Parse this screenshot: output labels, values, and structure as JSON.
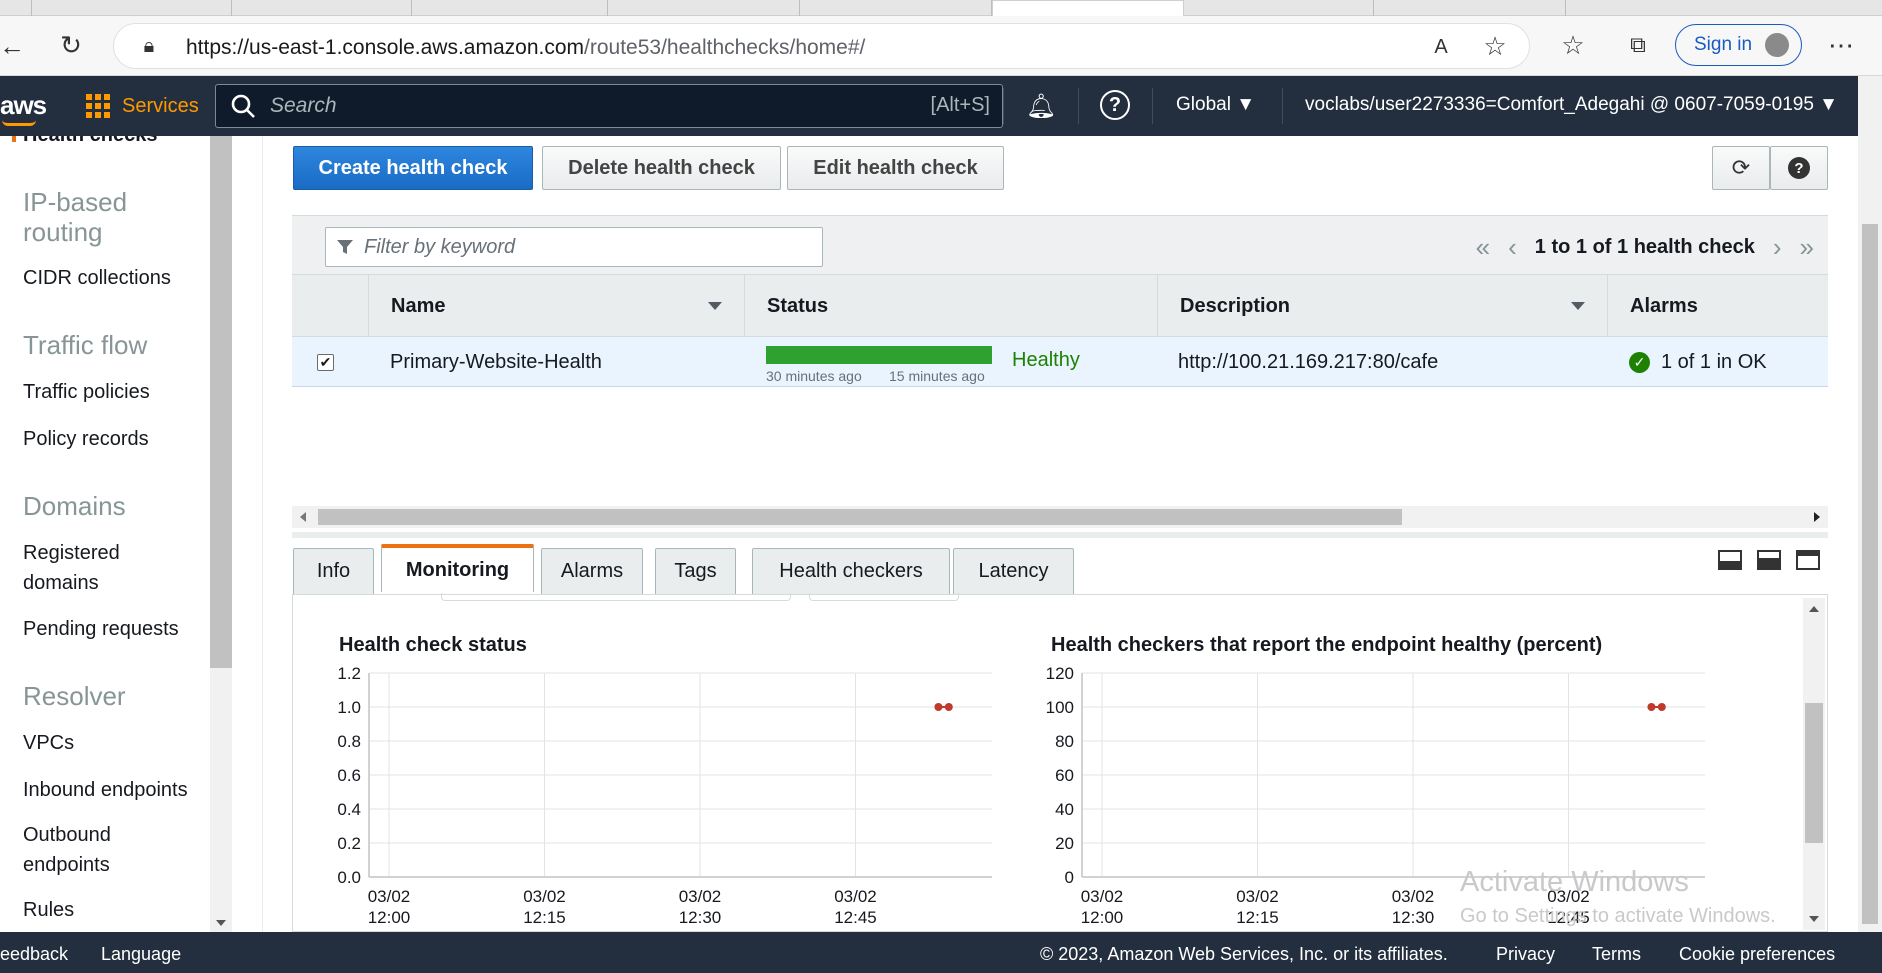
{
  "browser": {
    "url_host": "https://us-east-1.console.aws.amazon.com",
    "url_path": "/route53/healthchecks/home#/",
    "sign_in": "Sign in"
  },
  "aws_nav": {
    "logo": "aws",
    "services": "Services",
    "search_placeholder": "Search",
    "search_shortcut": "[Alt+S]",
    "region": "Global ▼",
    "account": "voclabs/user2273336=Comfort_Adegahi @ 0607-7059-0195 ▼"
  },
  "sidebar": {
    "cut_item": "Health checks",
    "ip_routing": "IP-based routing",
    "cidr": "CIDR collections",
    "traffic_flow": "Traffic flow",
    "traffic_policies": "Traffic policies",
    "policy_records": "Policy records",
    "domains": "Domains",
    "registered_domains": "Registered domains",
    "pending_requests": "Pending requests",
    "resolver": "Resolver",
    "vpcs": "VPCs",
    "inbound": "Inbound endpoints",
    "outbound": "Outbound endpoints",
    "rules": "Rules"
  },
  "actions": {
    "create": "Create health check",
    "delete": "Delete health check",
    "edit": "Edit health check"
  },
  "table": {
    "filter_placeholder": "Filter by keyword",
    "pager": "1 to 1 of 1 health check",
    "headers": {
      "name": "Name",
      "status": "Status",
      "description": "Description",
      "alarms": "Alarms"
    },
    "row": {
      "name": "Primary-Website-Health",
      "status_time_1": "30 minutes ago",
      "status_time_2": "15 minutes ago",
      "status": "Healthy",
      "description": "http://100.21.169.217:80/cafe",
      "alarms": "1 of 1 in OK"
    }
  },
  "tabs": [
    "Info",
    "Monitoring",
    "Alarms",
    "Tags",
    "Health checkers",
    "Latency"
  ],
  "chart_data": [
    {
      "type": "scatter",
      "title": "Health check status",
      "xticks": [
        "03/02\n12:00",
        "03/02\n12:15",
        "03/02\n12:30",
        "03/02\n12:45"
      ],
      "yticks": [
        "1.2",
        "1.0",
        "0.8",
        "0.6",
        "0.4",
        "0.2",
        "0.0"
      ],
      "ylim": [
        0,
        1.2
      ],
      "series": [
        {
          "points": [
            {
              "x": "12:53",
              "y": 1.0
            },
            {
              "x": "12:54",
              "y": 1.0
            }
          ],
          "color": "#c0392b"
        }
      ],
      "grid": true
    },
    {
      "type": "scatter",
      "title": "Health checkers that report the endpoint healthy (percent)",
      "xticks": [
        "03/02\n12:00",
        "03/02\n12:15",
        "03/02\n12:30",
        "03/02\n12:45"
      ],
      "yticks": [
        "120",
        "100",
        "80",
        "60",
        "40",
        "20",
        "0"
      ],
      "ylim": [
        0,
        120
      ],
      "series": [
        {
          "points": [
            {
              "x": "12:53",
              "y": 100
            },
            {
              "x": "12:54",
              "y": 100
            }
          ],
          "color": "#c0392b"
        }
      ],
      "grid": true
    }
  ],
  "watermark": {
    "line1": "Activate Windows",
    "line2": "Go to Settings to activate Windows."
  },
  "footer": {
    "feedback": "eedback",
    "language": "Language",
    "copyright": "© 2023, Amazon Web Services, Inc. or its affiliates.",
    "privacy": "Privacy",
    "terms": "Terms",
    "cookies": "Cookie preferences"
  }
}
